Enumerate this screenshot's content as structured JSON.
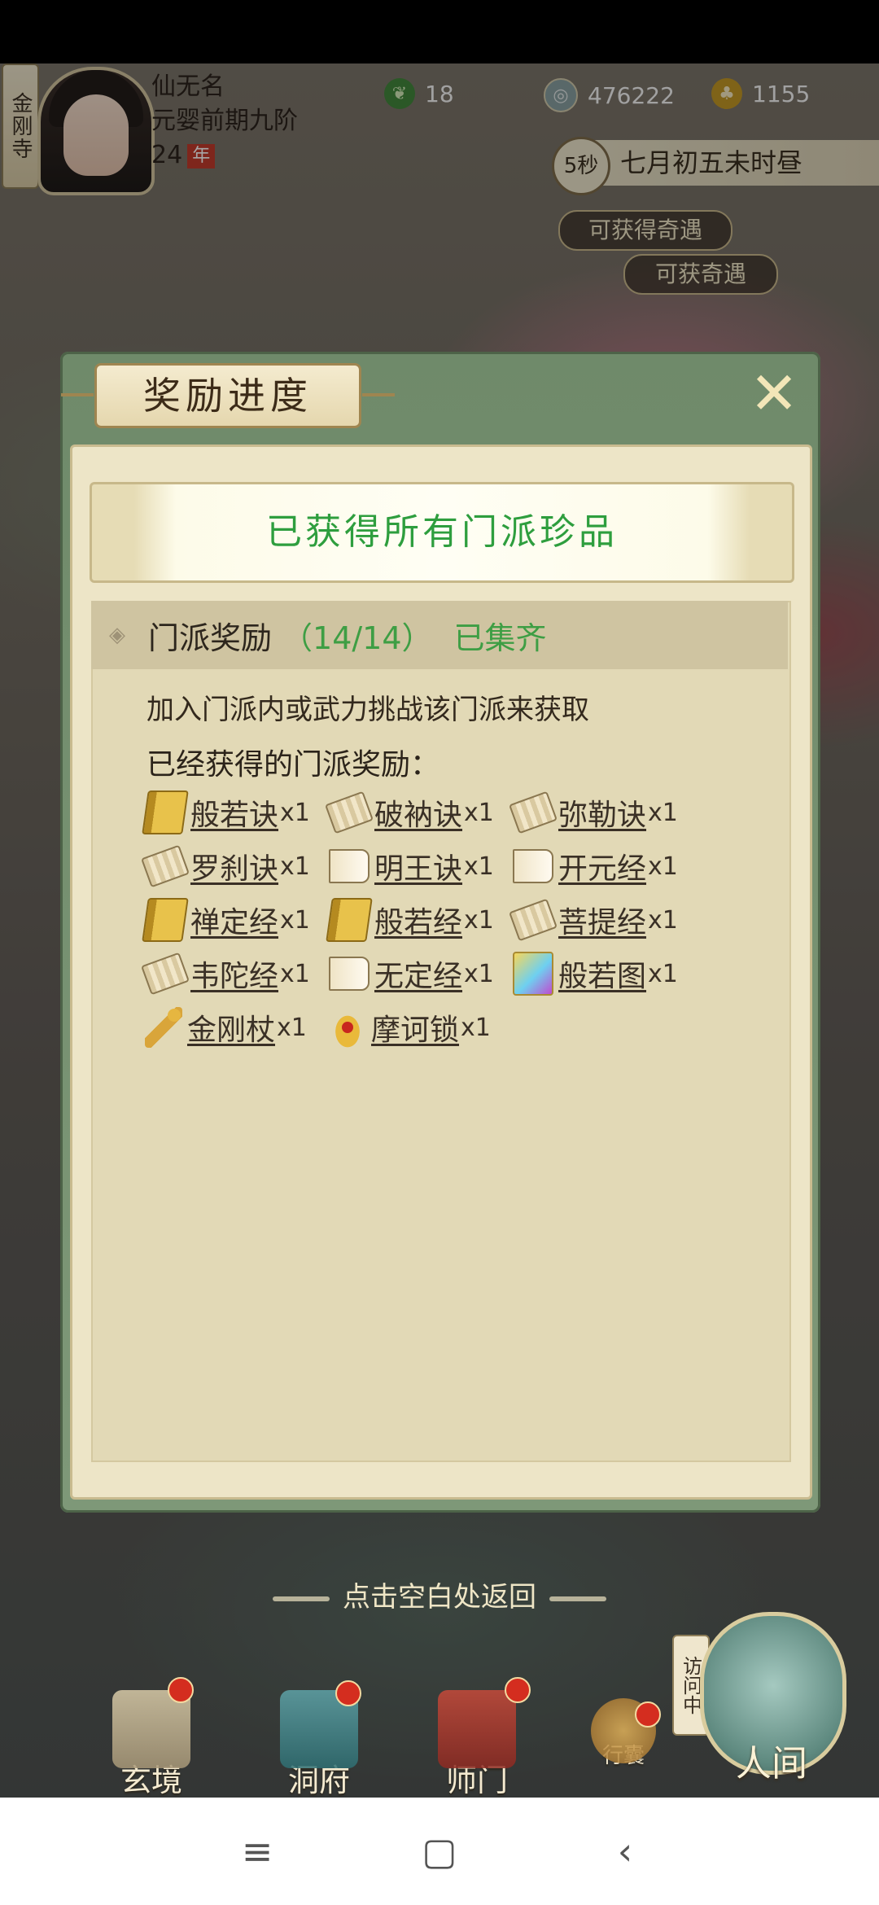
{
  "player": {
    "sect": "金刚寺",
    "name": "仙无名",
    "realm": "元婴前期九阶",
    "age": "24",
    "age_unit": "年"
  },
  "resources": [
    {
      "icon": "jade-icon",
      "value": "18"
    },
    {
      "icon": "coin-icon",
      "value": "476222"
    },
    {
      "icon": "gold-tree-icon",
      "value": "1155"
    }
  ],
  "time": {
    "countdown": "5秒",
    "date": "七月初五未时昼"
  },
  "events": {
    "encounter_1": "可获得奇遇",
    "encounter_2": "可获奇遇"
  },
  "dialog": {
    "title": "奖励进度",
    "close": "✕",
    "banner": "已获得所有门派珍品",
    "section_title": "门派奖励",
    "section_count": "（14/14）",
    "section_status": "已集齐",
    "hint": "加入门派内或武力挑战该门派来获取",
    "obtained_title": "已经获得的门派奖励：",
    "items": [
      {
        "name": "般若诀",
        "qty": "x1",
        "icon": "book"
      },
      {
        "name": "破衲诀",
        "qty": "x1",
        "icon": "scroll"
      },
      {
        "name": "弥勒诀",
        "qty": "x1",
        "icon": "scroll"
      },
      {
        "name": "罗刹诀",
        "qty": "x1",
        "icon": "scroll"
      },
      {
        "name": "明王诀",
        "qty": "x1",
        "icon": "open-scroll"
      },
      {
        "name": "开元经",
        "qty": "x1",
        "icon": "open-scroll"
      },
      {
        "name": "禅定经",
        "qty": "x1",
        "icon": "book"
      },
      {
        "name": "般若经",
        "qty": "x1",
        "icon": "book"
      },
      {
        "name": "菩提经",
        "qty": "x1",
        "icon": "scroll"
      },
      {
        "name": "韦陀经",
        "qty": "x1",
        "icon": "scroll"
      },
      {
        "name": "无定经",
        "qty": "x1",
        "icon": "open-scroll"
      },
      {
        "name": "般若图",
        "qty": "x1",
        "icon": "picture"
      },
      {
        "name": "金刚杖",
        "qty": "x1",
        "icon": "staff"
      },
      {
        "name": "摩诃锁",
        "qty": "x1",
        "icon": "lock"
      }
    ]
  },
  "back_hint": "点击空白处返回",
  "game_nav": {
    "xuanjing": "玄境",
    "dongfu": "洞府",
    "shimen": "师门",
    "xingnang": "行囊",
    "visiting": "访问中",
    "renjian": "人间"
  },
  "colors": {
    "accent_green": "#3e9e44",
    "panel_bg": "#e2d9b6",
    "dialog_frame": "#6f8a6a",
    "notification_red": "#d42d1f"
  }
}
